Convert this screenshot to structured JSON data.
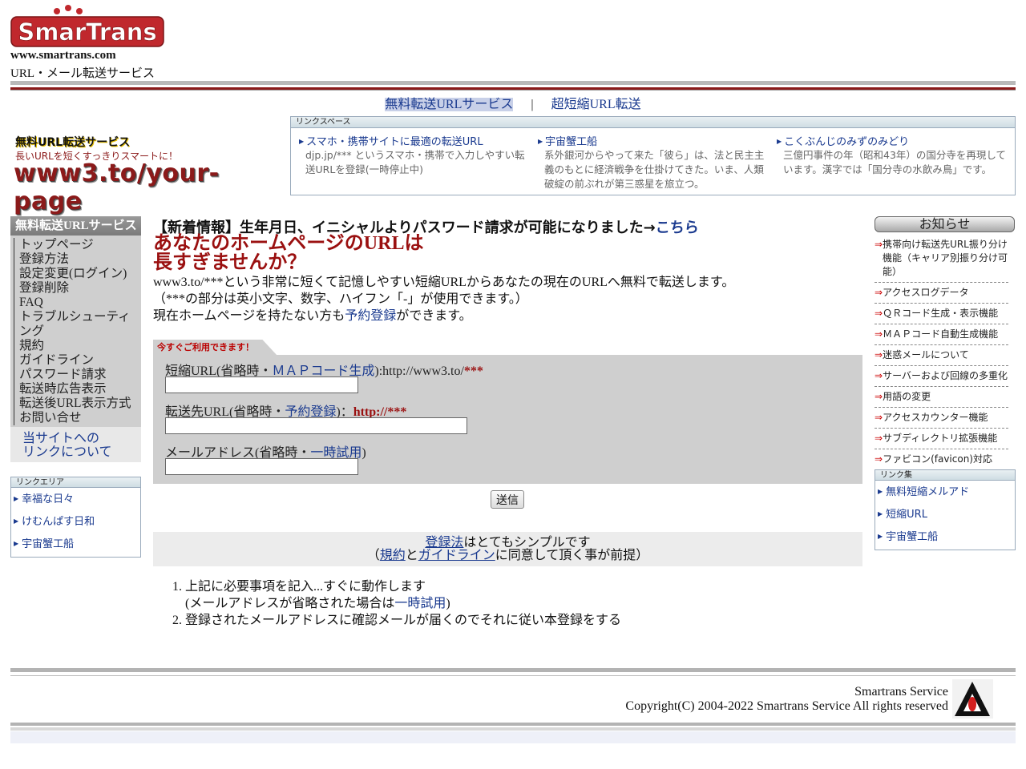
{
  "header": {
    "logo_text": "SmarTrans",
    "site_url": "www.smartrans.com",
    "site_desc": "URL・メール転送サービス"
  },
  "topnav": {
    "item1": "無料転送URLサービス",
    "sep": "|",
    "item2": "超短縮URL転送"
  },
  "banner": {
    "line1": "無料URL転送サービス",
    "line2": "長いURLを短くすっきりスマートに！",
    "line3": "www3.to/your-page"
  },
  "linkspace": {
    "title": "リンクスペース",
    "items": [
      {
        "title": "スマホ・携帯サイトに最適の転送URL",
        "desc": "djp.jp/*** というスマホ・携帯で入力しやすい転送URLを登録(一時停止中)"
      },
      {
        "title": "宇宙蟹工船",
        "desc": "系外銀河からやって来た「彼ら」は、法と民主主義のもとに経済戦争を仕掛けてきた。いま、人類破綻の前ぶれが第三惑星を旅立つ。"
      },
      {
        "title": "こくぶんじのみずのみどり",
        "desc": "三億円事件の年（昭和43年）の国分寺を再現しています。漢字では「国分寺の水飲み鳥」です。"
      }
    ]
  },
  "left_nav": {
    "title": "無料転送URLサービス",
    "items": [
      "トップページ",
      "登録方法",
      "設定変更(ログイン)",
      "登録削除",
      "FAQ",
      "トラブルシューティング",
      "規約",
      "ガイドライン",
      "パスワード請求",
      "転送時広告表示",
      "転送後URL表示方式",
      "お問い合せ"
    ],
    "note_line1": "当サイトへの",
    "note_line2": "リンクについて"
  },
  "link_area": {
    "title": "リンクエリア",
    "items": [
      "幸福な日々",
      "けむんぱす日和",
      "宇宙蟹工船"
    ]
  },
  "main": {
    "news_text": "【新着情報】生年月日、イニシャルよりパスワード請求が可能になりました→",
    "news_link": "こちら",
    "headline1": "あなたのホームページのURLは",
    "headline2": "長すぎませんか？",
    "intro1": "www3.to/***という非常に短くて記憶しやすい短縮URLからあなたの現在のURLへ無料で転送します。",
    "intro2": "（***の部分は英小文字、数字、ハイフン「-」が使用できます。）",
    "intro3_pre": "現在ホームページを持たない方も",
    "intro3_link": "予約登録",
    "intro3_post": "ができます。"
  },
  "form": {
    "tab_label": "今すぐご利用できます！",
    "short_label_pre": "短縮URL(省略時・",
    "short_label_link": "ＭＡＰコード生成",
    "short_label_post": "):http://www3.to/",
    "short_label_red": "***",
    "short_value": "",
    "dest_label_pre": "転送先URL(省略時・",
    "dest_label_link": "予約登録",
    "dest_label_post": ")：",
    "dest_label_red": "http://***",
    "dest_value": "",
    "mail_label_pre": "メールアドレス(省略時・",
    "mail_label_link": "一時試用",
    "mail_label_post": ")",
    "mail_value": "",
    "submit_label": "送信"
  },
  "simple_box": {
    "link1": "登録法",
    "text1": "はとてもシンプルです",
    "paren_open": "（",
    "link2": "規約",
    "and": "と",
    "link3": "ガイドライン",
    "text2": "に同意して頂く事が前提）"
  },
  "steps": {
    "step1": "上記に必要事項を記入...すぐに動作します",
    "step1_sub_pre": "(メールアドレスが省略された場合は",
    "step1_sub_link": "一時試用",
    "step1_sub_post": ")",
    "step2": "登録されたメールアドレスに確認メールが届くのでそれに従い本登録をする"
  },
  "right_sidebar": {
    "notice_title": "お知らせ",
    "arrow": "⇒",
    "notices": [
      "携帯向け転送先URL振り分け機能（キャリア別振り分け可能）",
      "アクセスログデータ",
      "ＱＲコード生成・表示機能",
      "ＭＡＰコード自動生成機能",
      "迷惑メールについて",
      "サーバーおよび回線の多重化",
      "用語の変更",
      "アクセスカウンター機能",
      "サブディレクトリ拡張機能",
      "ファビコン(favicon)対応"
    ],
    "links_title": "リンク集",
    "links": [
      "無料短縮メルアド",
      "短縮URL",
      "宇宙蟹工船"
    ]
  },
  "footer": {
    "line1": "Smartrans Service",
    "line2": "Copyright(C) 2004-2022 Smartrans Service All rights reserved"
  },
  "colors": {
    "brand_red": "#c0282d",
    "headline_red": "#9a1010",
    "link_blue": "#1a3a8f",
    "panel_gray": "#cfcfcf"
  }
}
